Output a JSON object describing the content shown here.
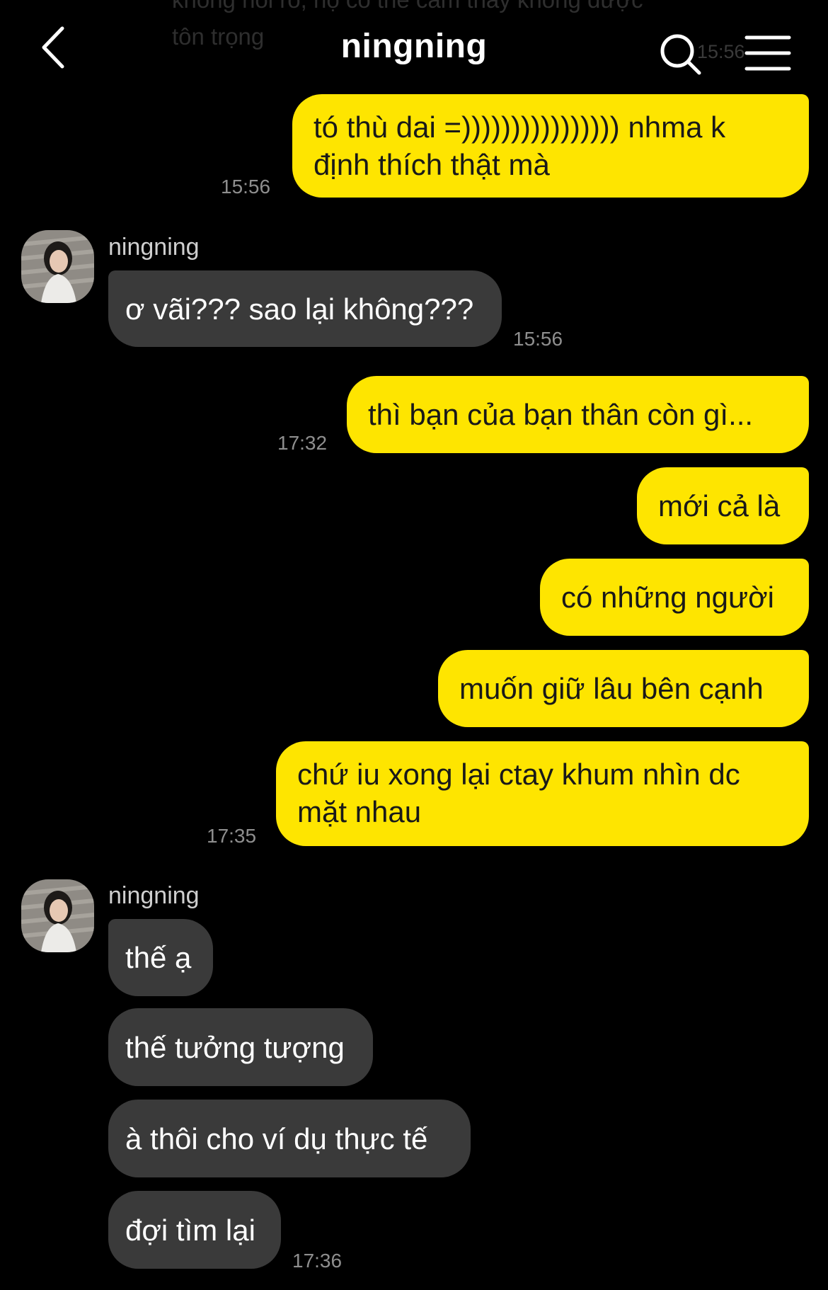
{
  "header": {
    "title": "ningning"
  },
  "ghost": {
    "text": "không nói rõ, họ có thể cảm thấy không được tôn trọng",
    "time": "15:56"
  },
  "sender_name": "ningning",
  "colors": {
    "my_bubble": "#FEE500",
    "their_bubble": "#3A3A3A",
    "background": "#000000"
  },
  "icons": {
    "back": "chevron-left-icon",
    "search": "search-icon",
    "menu": "hamburger-menu-icon"
  },
  "messages": [
    {
      "from": "me",
      "text": "tó thù dai =)))))))))))))))) nhma k định thích thật mà",
      "time": "15:56"
    },
    {
      "from": "them",
      "text": "ơ vãi??? sao lại không???",
      "time": "15:56"
    },
    {
      "from": "me",
      "text": "thì bạn của bạn thân còn gì...",
      "time": "17:32"
    },
    {
      "from": "me",
      "text": "mới cả là"
    },
    {
      "from": "me",
      "text": "có những người"
    },
    {
      "from": "me",
      "text": "muốn giữ lâu bên cạnh"
    },
    {
      "from": "me",
      "text": "chứ iu xong lại ctay khum nhìn dc mặt nhau",
      "time": "17:35"
    },
    {
      "from": "them",
      "text": "thế ạ"
    },
    {
      "from": "them",
      "text": "thế tưởng tượng"
    },
    {
      "from": "them",
      "text": "à thôi cho ví dụ thực tế"
    },
    {
      "from": "them",
      "text": "đợi tìm lại",
      "time": "17:36"
    }
  ]
}
